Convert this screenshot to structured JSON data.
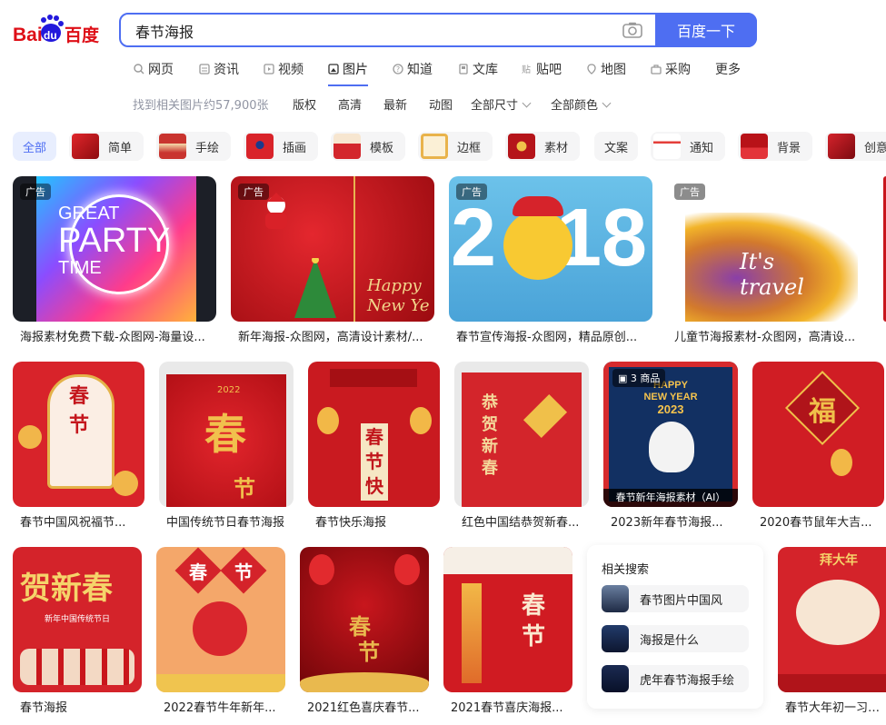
{
  "brand": {
    "logo_text_left": "Bai",
    "logo_text_mid": "du",
    "logo_text_right": "百度"
  },
  "search": {
    "query": "春节海报",
    "button_label": "百度一下"
  },
  "nav": [
    {
      "label": "网页",
      "icon": "search-icon"
    },
    {
      "label": "资讯",
      "icon": "news-icon"
    },
    {
      "label": "视频",
      "icon": "video-icon"
    },
    {
      "label": "图片",
      "icon": "image-icon",
      "active": true
    },
    {
      "label": "知道",
      "icon": "question-icon"
    },
    {
      "label": "文库",
      "icon": "document-icon"
    },
    {
      "label": "贴吧",
      "icon": "tieba-icon"
    },
    {
      "label": "地图",
      "icon": "map-icon"
    },
    {
      "label": "采购",
      "icon": "cart-icon"
    },
    {
      "label": "更多"
    }
  ],
  "filters": {
    "result_count": "找到相关图片约57,900张",
    "options": [
      "版权",
      "高清",
      "最新",
      "动图"
    ],
    "size_dropdown": "全部尺寸",
    "color_dropdown": "全部颜色"
  },
  "tags": [
    "全部",
    "简单",
    "手绘",
    "插画",
    "模板",
    "边框",
    "素材",
    "文案",
    "通知",
    "背景",
    "创意"
  ],
  "row1": [
    {
      "caption": "海报素材免费下载-众图网-海量设...",
      "ad": "广告",
      "art": [
        "GREAT",
        "PARTY",
        "TIME"
      ]
    },
    {
      "caption": "新年海报-众图网，高清设计素材/...",
      "ad": "广告",
      "art": [
        "Happy",
        "New Ye"
      ]
    },
    {
      "caption": "春节宣传海报-众图网，精品原创...",
      "ad": "广告",
      "art": [
        "2",
        "18"
      ]
    },
    {
      "caption": "儿童节海报素材-众图网，高清设...",
      "ad": "广告",
      "art": [
        "It's",
        "travel"
      ]
    }
  ],
  "row2": [
    {
      "caption": "春节中国风祝福节...",
      "art": [
        "春",
        "节"
      ]
    },
    {
      "caption": "中国传统节日春节海报",
      "art": [
        "2022",
        "春",
        "节"
      ]
    },
    {
      "caption": "春节快乐海报",
      "art": [
        "春",
        "节",
        "快"
      ]
    },
    {
      "caption": "红色中国结恭贺新春...",
      "art": [
        "恭",
        "贺",
        "新",
        "春"
      ]
    },
    {
      "caption": "2023新年春节海报...",
      "badge_count": "3",
      "badge_label": "商品",
      "overlay": "春节新年海报素材（AI）",
      "art": [
        "HAPPY",
        "NEW YEAR",
        "2023"
      ]
    },
    {
      "caption": "2020春节鼠年大吉...",
      "art": [
        "福"
      ]
    }
  ],
  "row3": [
    {
      "caption": "春节海报",
      "art": [
        "贺新春",
        "新年中国传统节日"
      ]
    },
    {
      "caption": "2022春节牛年新年...",
      "art": [
        "春",
        "节"
      ]
    },
    {
      "caption": "2021红色喜庆春节...",
      "art": [
        "春",
        "节"
      ]
    },
    {
      "caption": "2021春节喜庆海报...",
      "art": [
        "春",
        "节"
      ]
    },
    {
      "caption": "春节大年初一习俗...",
      "art": [
        "拜大年"
      ]
    }
  ],
  "related": {
    "title": "相关搜索",
    "items": [
      "春节图片中国风",
      "海报是什么",
      "虎年春节海报手绘"
    ]
  },
  "colors": {
    "accent": "#4e6ef2",
    "festive_red": "#c8161d",
    "gold": "#e8b450"
  }
}
